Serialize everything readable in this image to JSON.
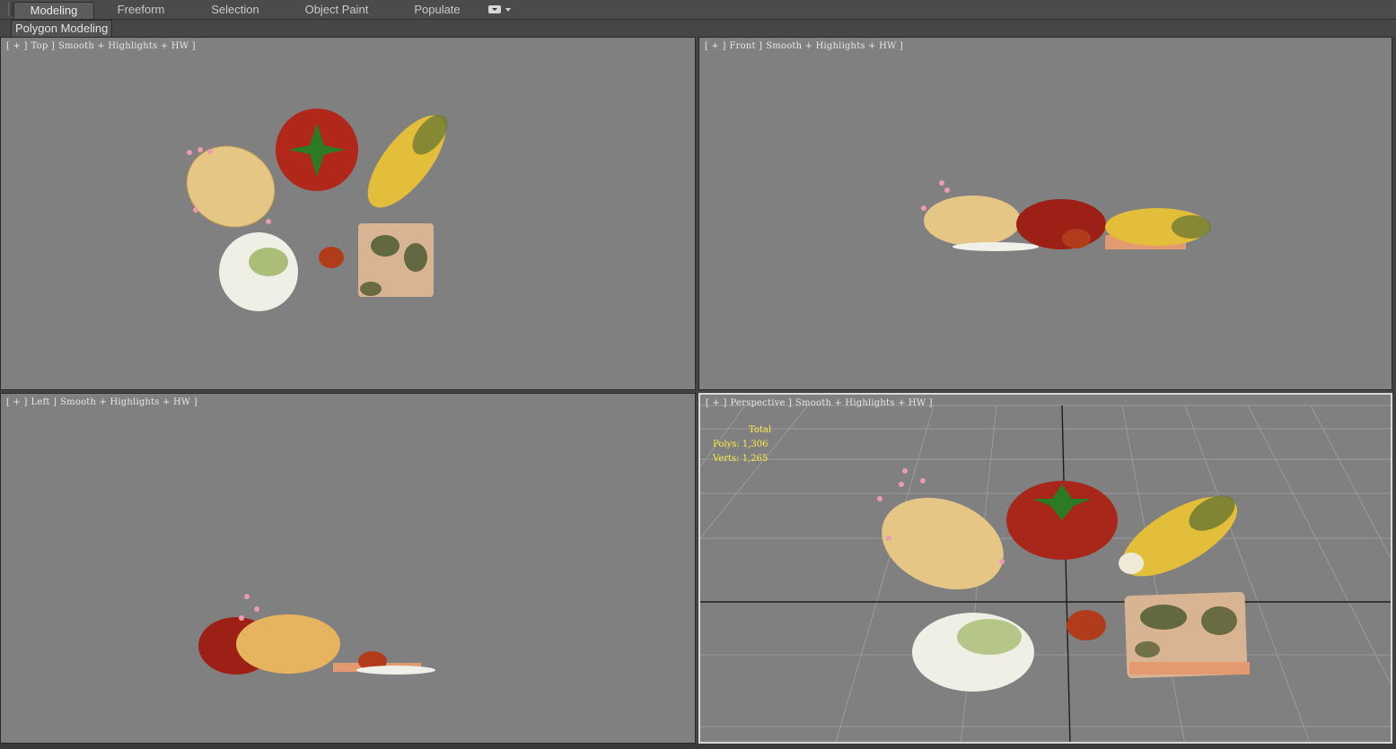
{
  "ribbon": {
    "tabs": [
      {
        "label": "Modeling",
        "active": true
      },
      {
        "label": "Freeform",
        "active": false
      },
      {
        "label": "Selection",
        "active": false
      },
      {
        "label": "Object Paint",
        "active": false
      },
      {
        "label": "Populate",
        "active": false
      }
    ],
    "panel_label": "Polygon Modeling"
  },
  "viewports": {
    "top": {
      "plus": "[ + ]",
      "name": "Top ]",
      "shading": "Smooth + Highlights + HW ]"
    },
    "front": {
      "plus": "[ + ]",
      "name": "Front ]",
      "shading": "Smooth + Highlights + HW ]"
    },
    "left": {
      "plus": "[ + ]",
      "name": "Left ]",
      "shading": "Smooth + Highlights + HW ]"
    },
    "perspective": {
      "plus": "[ + ]",
      "name": "Perspective ]",
      "shading": "Smooth + Highlights + HW ]",
      "stats": {
        "title": "Total",
        "polys": "Polys: 1,306",
        "verts": "Verts: 1,265"
      }
    }
  },
  "colors": {
    "viewport_bg": "#808080",
    "ui_bg": "#444444",
    "stats_text": "#ffee40",
    "grid_line": "#9a9a9a",
    "axis_line": "#1e1e1e"
  },
  "scene_objects": [
    "potato-sprouted",
    "tomato",
    "corn-cob",
    "moldy-bread-slice",
    "moldy-rice-cake",
    "small-tomato"
  ]
}
